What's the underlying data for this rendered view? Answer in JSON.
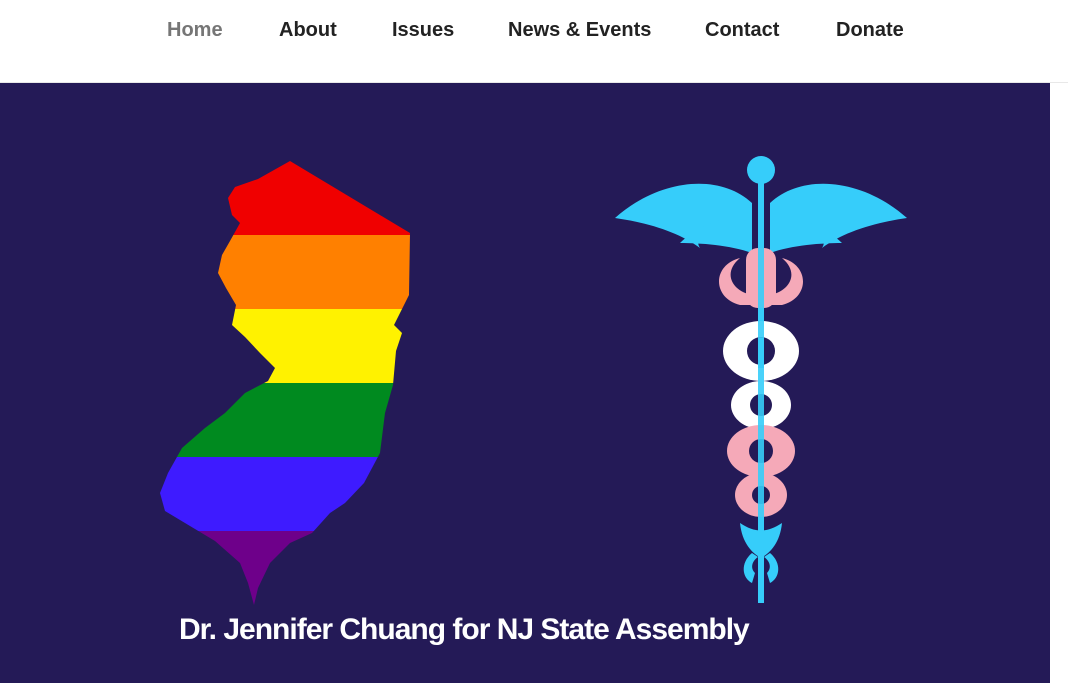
{
  "nav": {
    "items": [
      {
        "label": "Home",
        "active": true
      },
      {
        "label": "About",
        "active": false
      },
      {
        "label": "Issues",
        "active": false
      },
      {
        "label": "News & Events",
        "active": false
      },
      {
        "label": "Contact",
        "active": false
      },
      {
        "label": "Donate",
        "active": false
      }
    ]
  },
  "hero": {
    "background": "#241a57",
    "title": "Dr. Jennifer Chuang for NJ State Assembly",
    "left_image": {
      "icon": "new-jersey-rainbow-map",
      "stripe_colors": [
        "#f00000",
        "#ff8000",
        "#fff200",
        "#008a1f",
        "#3e1bff",
        "#6e008a"
      ]
    },
    "right_image": {
      "icon": "caduceus-trans-flag",
      "colors": [
        "#36cdfa",
        "#f5a9b8",
        "#ffffff"
      ]
    }
  }
}
